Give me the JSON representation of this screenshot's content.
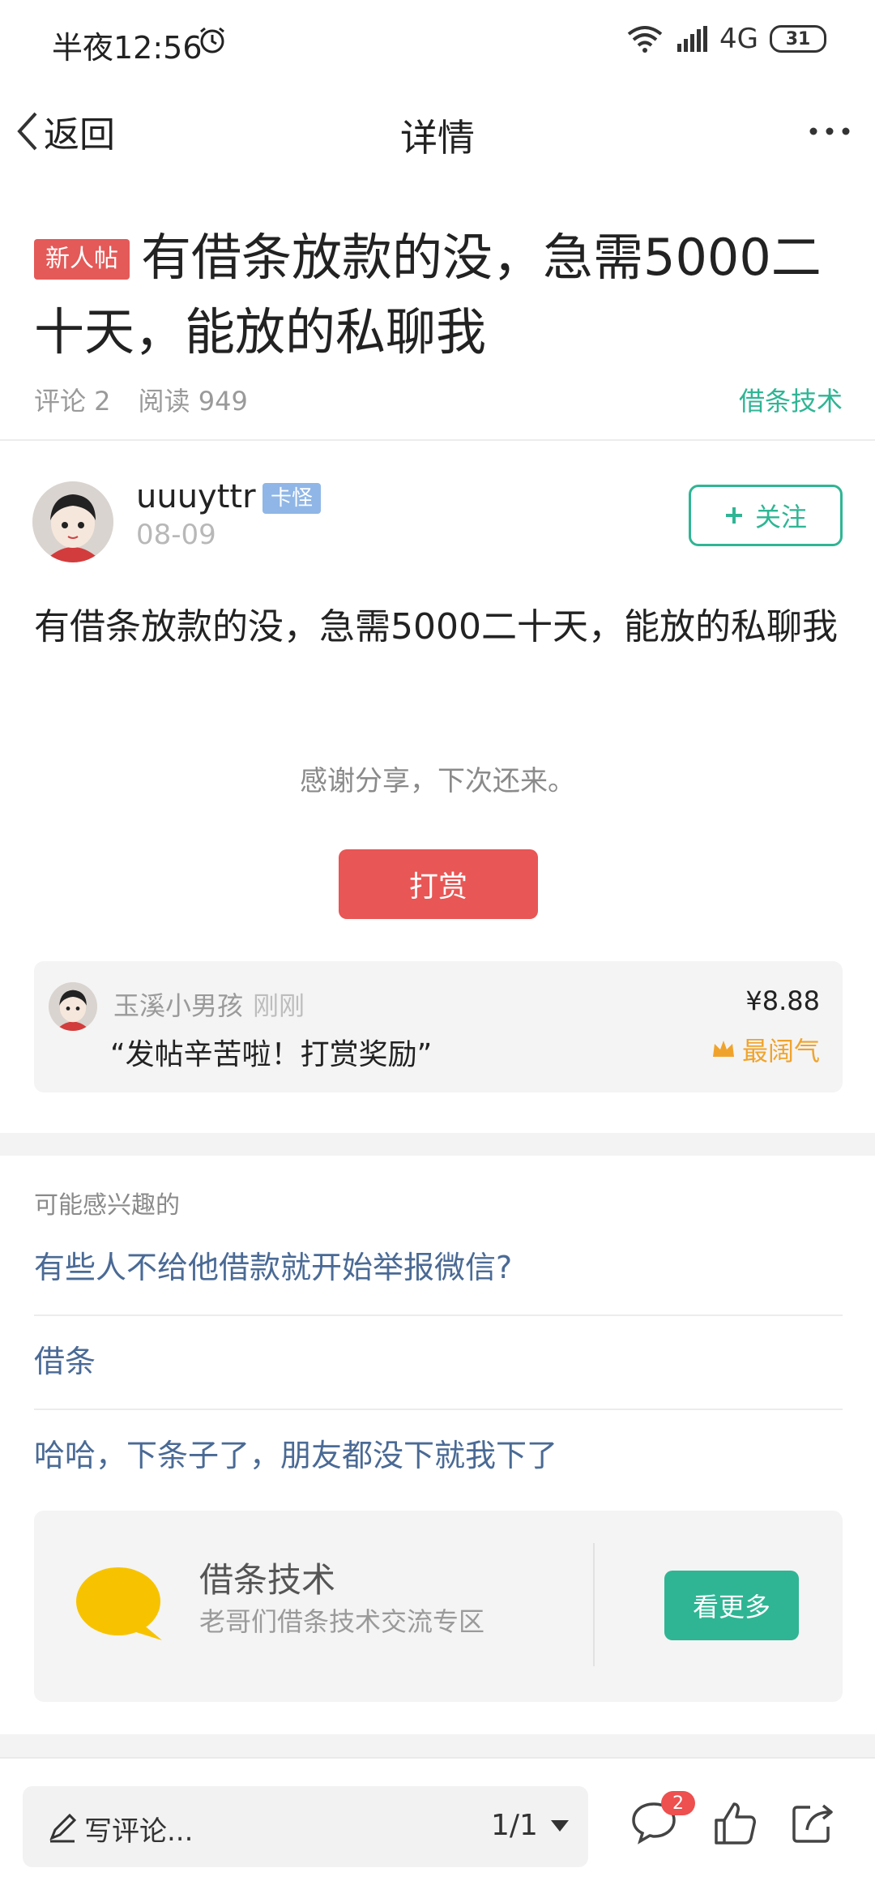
{
  "status_bar": {
    "time": "半夜12:56",
    "network": "4G",
    "battery": "31"
  },
  "nav": {
    "back_label": "返回",
    "title": "详情"
  },
  "post": {
    "badge": "新人帖",
    "title": "有借条放款的没，急需5000二十天，能放的私聊我",
    "comments": "评论 2",
    "reads": "阅读 949",
    "category": "借条技术",
    "author": {
      "name": "uuuyttr",
      "badge": "卡怪",
      "date": "08-09",
      "follow_label": "关注"
    },
    "body": "有借条放款的没，急需5000二十天，能放的私聊我",
    "thanks_text": "感谢分享，下次还来。",
    "reward_button": "打赏"
  },
  "reward": {
    "user": "玉溪小男孩",
    "time": "刚刚",
    "message": "“发帖辛苦啦！打赏奖励”",
    "amount": "¥8.88",
    "tag": "最阔气"
  },
  "recommend": {
    "heading": "可能感兴趣的",
    "items": [
      "有些人不给他借款就开始举报微信?",
      "借条",
      "哈哈，下条子了，朋友都没下就我下了"
    ]
  },
  "circle": {
    "name": "借条技术",
    "desc": "老哥们借条技术交流专区",
    "button": "看更多"
  },
  "bottom_bar": {
    "placeholder": "写评论...",
    "pager": "1/1",
    "comment_badge": "2"
  },
  "colors": {
    "accent_green": "#2fb594",
    "reward_red": "#e85655",
    "link_blue": "#4a6a95"
  }
}
